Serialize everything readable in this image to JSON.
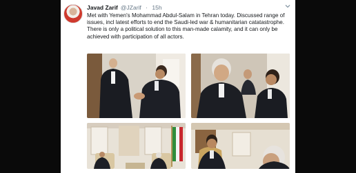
{
  "tweet": {
    "author_name": "Javad Zarif",
    "handle": "@JZarif",
    "separator": "·",
    "time": "15h",
    "text_paragraphs": [
      "Met with Yemen's Mohammad Abdul-Salam in Tehran today. Discussed range of issues, incl latest efforts to end the Saudi-led war & humanitarian catatastrophe.",
      "There is only a political solution to this man-made calamity, and it can only be achieved with participation of all actors."
    ]
  },
  "icons": {
    "avatar": "profile-photo",
    "menu": "chevron-down-icon"
  },
  "photos": [
    {
      "name": "handshake"
    },
    {
      "name": "greeting-closeup"
    },
    {
      "name": "meeting-wide"
    },
    {
      "name": "meeting-closeup"
    }
  ],
  "colors": {
    "background": "#0a0a0a",
    "card": "#ffffff",
    "text": "#14171a",
    "meta": "#657786"
  }
}
